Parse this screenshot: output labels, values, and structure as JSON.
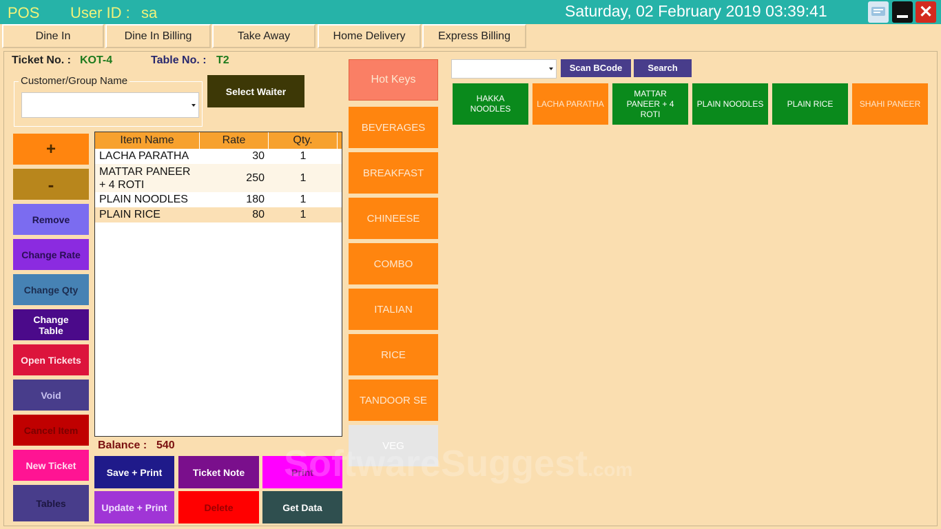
{
  "titlebar": {
    "app_name": "POS",
    "user_label": "User ID :",
    "user_value": "sa",
    "datetime": "Saturday, 02 February 2019 03:39:41"
  },
  "tabs": [
    {
      "label": "Dine In",
      "active": true
    },
    {
      "label": "Dine In Billing"
    },
    {
      "label": "Take Away"
    },
    {
      "label": "Home Delivery"
    },
    {
      "label": "Express Billing"
    }
  ],
  "ticket": {
    "ticket_label": "Ticket No. :",
    "ticket_value": "KOT-4",
    "table_label": "Table No. :",
    "table_value": "T2"
  },
  "customer": {
    "group_label": "Customer/Group Name",
    "value": ""
  },
  "select_waiter": "Select Waiter",
  "side_buttons": {
    "plus": "+",
    "minus": "-",
    "remove": "Remove",
    "change_rate": "Change Rate",
    "change_qty": "Change Qty",
    "change_table": "Change Table",
    "open_tickets": "Open Tickets",
    "void": "Void",
    "cancel_item": "Cancel Item",
    "new_ticket": "New Ticket",
    "tables": "Tables"
  },
  "grid": {
    "headers": [
      "Item Name",
      "Rate",
      "Qty."
    ],
    "rows": [
      {
        "item": "LACHA PARATHA",
        "rate": "30",
        "qty": "1"
      },
      {
        "item": "MATTAR PANEER + 4 ROTI",
        "rate": "250",
        "qty": "1"
      },
      {
        "item": "PLAIN NOODLES",
        "rate": "180",
        "qty": "1"
      },
      {
        "item": "PLAIN RICE",
        "rate": "80",
        "qty": "1"
      }
    ]
  },
  "balance": {
    "label": "Balance :",
    "value": "540"
  },
  "bottom_buttons": {
    "save_print": "Save + Print",
    "ticket_note": "Ticket Note",
    "print": "Print",
    "update_print": "Update + Print",
    "delete": "Delete",
    "get_data": "Get Data"
  },
  "categories": {
    "hot_keys": "Hot Keys",
    "list": [
      "BEVERAGES",
      "BREAKFAST",
      "CHINEESE",
      "COMBO",
      "ITALIAN",
      "RICE",
      "TANDOOR SE",
      "VEG"
    ]
  },
  "search": {
    "combo_value": "",
    "scan_label": "Scan BCode",
    "search_label": "Search"
  },
  "items": [
    {
      "label": "HAKKA NOODLES",
      "color": "#0a8a1c"
    },
    {
      "label": "LACHA PARATHA",
      "color": "#ff850f"
    },
    {
      "label": "MATTAR PANEER + 4 ROTI",
      "color": "#0a8a1c"
    },
    {
      "label": "PLAIN NOODLES",
      "color": "#0a8a1c"
    },
    {
      "label": "PLAIN RICE",
      "color": "#0a8a1c"
    },
    {
      "label": "SHAHI PANEER",
      "color": "#ff850f"
    }
  ],
  "watermark": {
    "main": "SoftwareSuggest",
    "suffix": ".com"
  }
}
